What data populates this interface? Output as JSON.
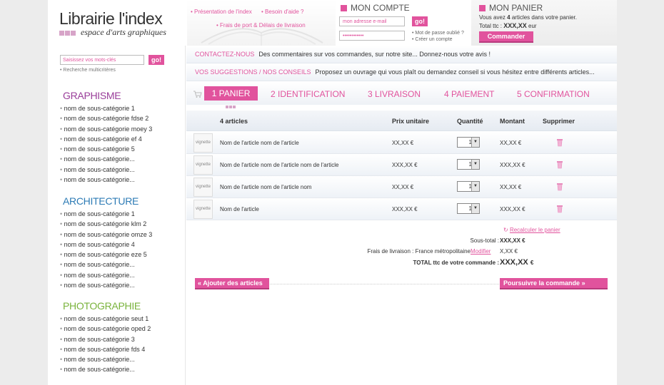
{
  "header": {
    "logo_title": "Librairie l'index",
    "logo_subtitle": "espace d'arts graphiques",
    "links": {
      "presentation": "Présentation de l'index",
      "aide": "Besoin d'aide ?",
      "frais": "Frais de port & Délais de livraison"
    }
  },
  "account": {
    "title": "MON COMPTE",
    "email_placeholder": "mon adresse e-mail",
    "password_value": "••••••••••••",
    "go_label": "go!",
    "forgot": "Mot de passe oublié ?",
    "create": "Créer un compte"
  },
  "basket": {
    "title": "MON PANIER",
    "line_prefix": "Vous avez",
    "count": "4",
    "line_suffix": "articles dans votre panier.",
    "total_label": "Total ttc :",
    "total_value": "XXX,XX",
    "total_unit": "eur",
    "order_button": "Commander"
  },
  "search": {
    "placeholder": "Saisissez vos mots-clés",
    "go_label": "go!",
    "advanced": "Recherche multicritères"
  },
  "categories": [
    {
      "title": "GRAPHISME",
      "color": "#9a3e9a",
      "items": [
        "nom de sous-catégorie 1",
        "nom de sous-catégorie fdse 2",
        "nom de sous-catégorie moey 3",
        "nom de sous-catégorie ef 4",
        "nom de sous-catégorie 5",
        "nom de sous-catégorie...",
        "nom de sous-catégorie...",
        "nom de sous-catégorie..."
      ]
    },
    {
      "title": "ARCHITECTURE",
      "color": "#2d7bb5",
      "items": [
        "nom de sous-catégorie 1",
        "nom de sous-catégorie klm 2",
        "nom de sous-catégorie omze 3",
        "nom de sous-catégorie 4",
        "nom de sous-catégorie eze 5",
        "nom de sous-catégorie...",
        "nom de sous-catégorie...",
        "nom de sous-catégorie..."
      ]
    },
    {
      "title": "PHOTOGRAPHIE",
      "color": "#7ab33c",
      "items": [
        "nom de sous-catégorie seut 1",
        "nom de sous-catégorie oped 2",
        "nom de sous-catégorie 3",
        "nom de sous-catégorie fds 4",
        "nom de sous-catégorie...",
        "nom de sous-catégorie..."
      ]
    }
  ],
  "infobars": {
    "contact_label": "CONTACTEZ-NOUS",
    "contact_text": "Des commentaires sur vos commandes, sur notre site... Donnez-nous votre avis !",
    "suggest_label": "VOS SUGGESTIONS / NOS CONSEILS",
    "suggest_text": "Proposez un ouvrage qui vous plaît ou demandez conseil si vous hésitez entre différents articles..."
  },
  "steps": [
    "1 PANIER",
    "2 IDENTIFICATION",
    "3 LIVRAISON",
    "4 PAIEMENT",
    "5 CONFIRMATION"
  ],
  "table": {
    "headers": {
      "articles": "4 articles",
      "prix": "Prix unitaire",
      "quantite": "Quantité",
      "montant": "Montant",
      "supprimer": "Supprimer"
    },
    "thumb_label": "vignette",
    "rows": [
      {
        "name": "Nom de l'article nom de l'article",
        "price": "XX,XX €",
        "qty": "1",
        "amount": "XX,XX €"
      },
      {
        "name": "Nom de l'article nom de l'article nom de l'article",
        "price": "XXX,XX €",
        "qty": "1",
        "amount": "XXX,XX €"
      },
      {
        "name": "Nom de l'article nom de l'article nom",
        "price": "XX,XX  €",
        "qty": "1",
        "amount": "XX,XX €"
      },
      {
        "name": "Nom de l'article",
        "price": "XXX,XX €",
        "qty": "1",
        "amount": "XXX,XX €"
      }
    ]
  },
  "totals": {
    "recalc": "Recalculer le panier",
    "subtotal_label": "Sous-total :",
    "subtotal_value": "XXX,XX €",
    "shipping_label": "Frais de livraison : France métropolitaine",
    "shipping_modify": "Modifier",
    "shipping_value": "X,XX €",
    "total_label": "TOTAL ttc de votre commande :",
    "total_value": "XXX,XX",
    "total_unit": "€"
  },
  "actions": {
    "add_more": "Ajouter des articles",
    "continue": "Poursuivre la commande"
  }
}
